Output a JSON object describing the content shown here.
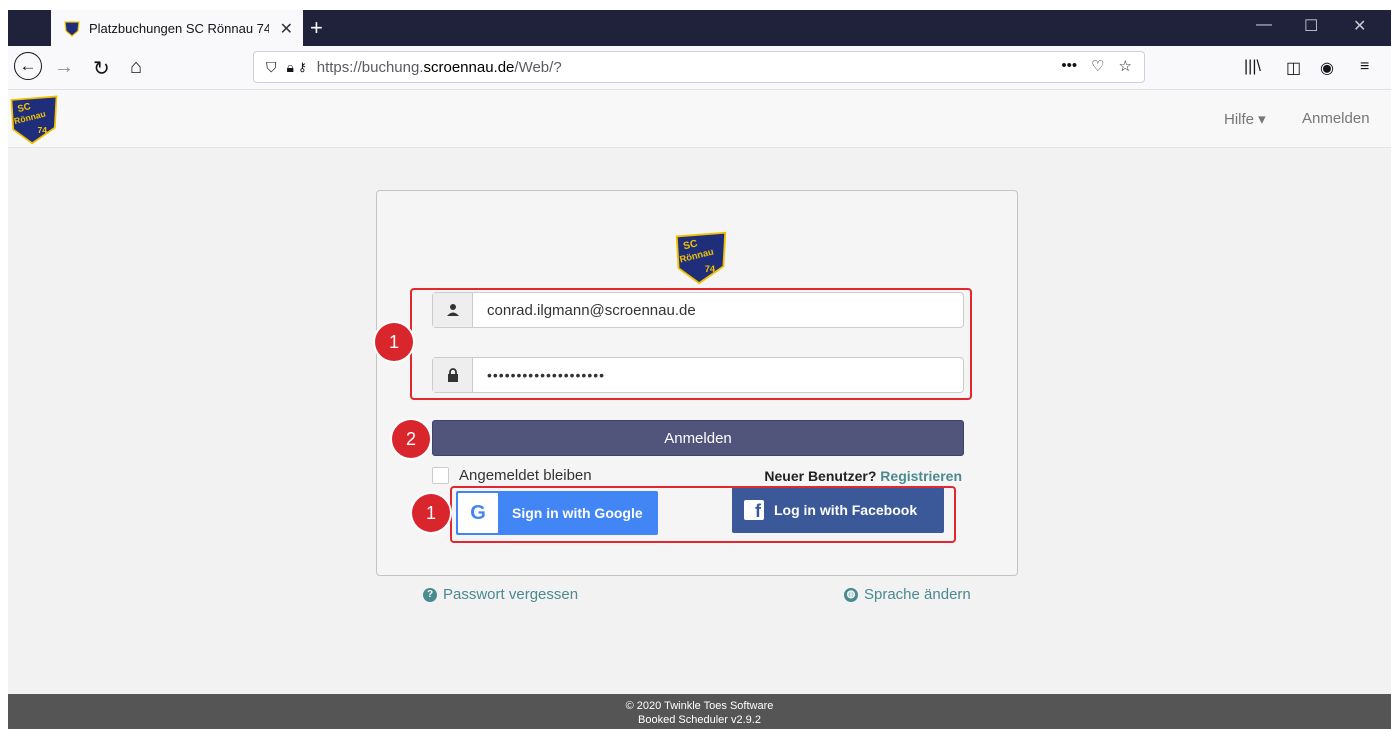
{
  "browser": {
    "tab_title": "Platzbuchungen SC Rönnau 74",
    "tab_close": "✕",
    "newtab": "+",
    "url_prefix": "https://buchung.",
    "url_domain": "scroennau.de",
    "url_path": "/Web/?"
  },
  "header": {
    "logo_top": "SC",
    "logo_mid": "Rönnau",
    "logo_num": "74",
    "help_label": "Hilfe ▾",
    "login_label": "Anmelden"
  },
  "login": {
    "email_value": "conrad.ilgmann@scroennau.de",
    "password_mask": "••••••••••••••••••••",
    "submit_label": "Anmelden",
    "remember_label": "Angemeldet bleiben",
    "new_user_label": "Neuer Benutzer?",
    "register_label": "Registrieren",
    "google_label": "Sign in with Google",
    "google_glyph": "G",
    "facebook_label": "Log in with Facebook",
    "facebook_glyph": "f"
  },
  "links": {
    "forgot_password": "Passwort vergessen",
    "change_language": "Sprache ändern"
  },
  "annotations": {
    "credentials_step": "1",
    "submit_step": "2",
    "social_step": "1"
  },
  "footer": {
    "copyright": "© 2020 Twinkle Toes Software",
    "version": "Booked Scheduler v2.9.2"
  },
  "colors": {
    "submit_button": "#51557c",
    "link": "#4a8a90",
    "annotation": "#e2272e",
    "google": "#4285f4",
    "facebook": "#3b5998"
  }
}
